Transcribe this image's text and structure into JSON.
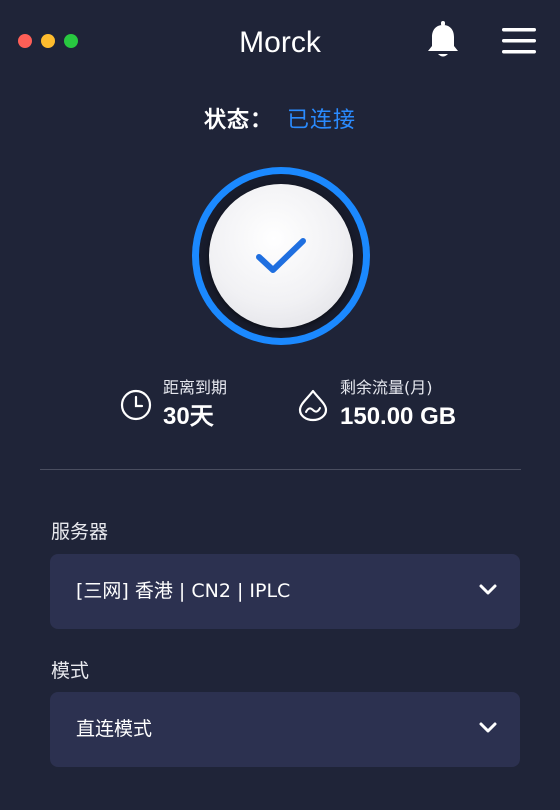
{
  "app": {
    "title": "Morck"
  },
  "status": {
    "label": "状态：",
    "value": "已连接",
    "accent": "#2a8bff"
  },
  "connect_button": {
    "icon": "check-icon",
    "state": "connected"
  },
  "stats": {
    "expire": {
      "label": "距离到期",
      "value": "30天",
      "icon": "clock-icon"
    },
    "traffic": {
      "label": "剩余流量(月)",
      "value": "150.00 GB",
      "icon": "droplet-icon"
    }
  },
  "server": {
    "label": "服务器",
    "selected": "[三网] 香港 | CN2 | IPLC"
  },
  "mode": {
    "label": "模式",
    "selected": "直连模式"
  },
  "colors": {
    "background": "#1f2438",
    "panel": "#2c3150",
    "accent": "#1b89ff"
  }
}
